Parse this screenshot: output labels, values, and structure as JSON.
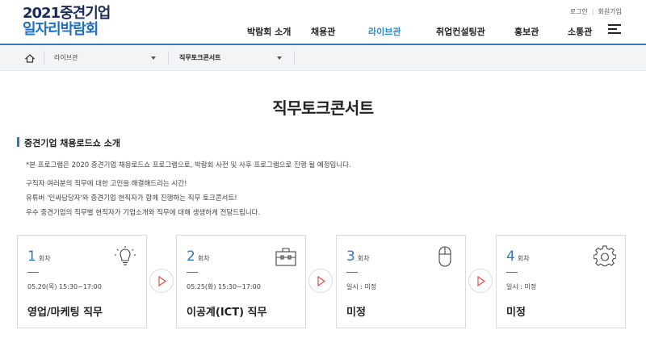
{
  "header": {
    "logo_line1": "2021중견기업",
    "logo_line2": "일자리박람회",
    "util": {
      "login": "로그인",
      "join": "회원가입"
    },
    "nav": [
      "박람회 소개",
      "채용관",
      "라이브관",
      "취업컨설팅관",
      "홍보관",
      "소통관"
    ],
    "active_nav": "라이브관",
    "accent": "#2f78c2",
    "active_color": "#1e8fd8"
  },
  "breadcrumb": {
    "level1": "라이브관",
    "level2": "직무토크콘서트"
  },
  "page": {
    "title": "직무토크콘서트",
    "section_title": "중견기업 채용로드쇼 소개",
    "note": "*본 프로그램은 2020 중견기업 채용로드쇼 프로그램으로, 박람회 사전 및 사후 프로그램으로 진행 될 예정입니다.",
    "lines": [
      "구직자 여러분의 직무에 대한 고민을 해결해드리는 시간!",
      "유튜버 '인싸담당자'와 중견기업 현직자가 함께 진행하는 직무 토크콘서트!",
      "우수 중견기업의 직무별 현직자가 기업소개와 직무에 대해 생생하게 전달드립니다."
    ]
  },
  "sessions": [
    {
      "num": "1",
      "unit": "회차",
      "date": "05.20(목) 15:30~17:00",
      "job": "영업/마케팅 직무",
      "icon": "lightbulb-icon"
    },
    {
      "num": "2",
      "unit": "회차",
      "date": "05.25(화) 15:30~17:00",
      "job": "이공계(ICT) 직무",
      "icon": "briefcase-icon"
    },
    {
      "num": "3",
      "unit": "회차",
      "date": "일시 : 미정",
      "job": "미정",
      "icon": "mouse-icon"
    },
    {
      "num": "4",
      "unit": "회차",
      "date": "일시 : 미정",
      "job": "미정",
      "icon": "gear-icon"
    }
  ]
}
